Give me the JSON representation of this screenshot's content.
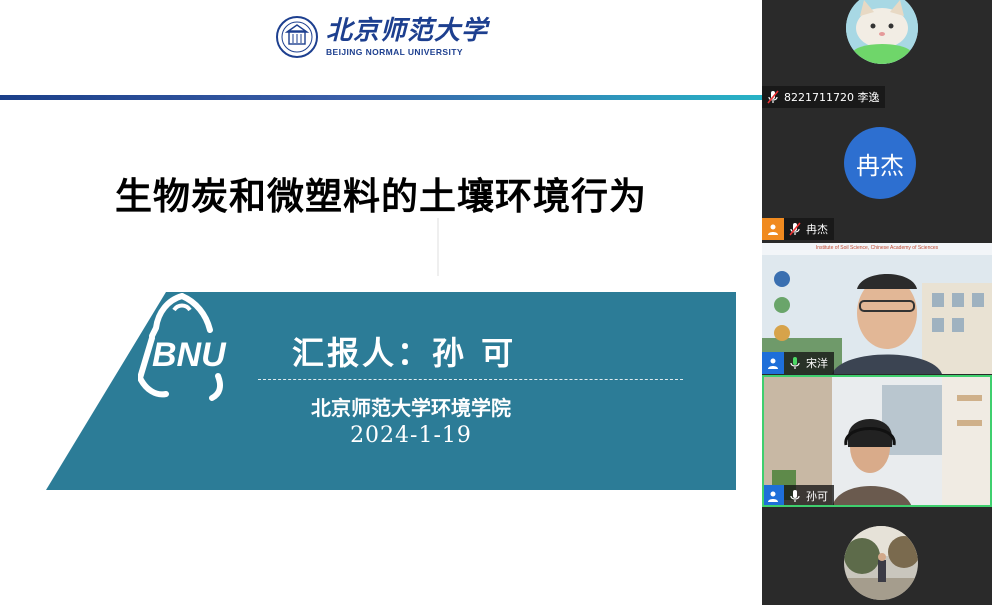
{
  "slide": {
    "logo_cn": "北京师范大学",
    "logo_en": "BEIJING NORMAL UNIVERSITY",
    "title": "生物炭和微塑料的土壤环境行为",
    "bnu_mark": "BNU",
    "presenter": "汇报人：孙 可",
    "school": "北京师范大学环境学院",
    "date": "2024-1-19"
  },
  "participants": [
    {
      "name": "8221711720 李逸",
      "avatar": "cat-photo-avatar",
      "mic": "muted"
    },
    {
      "name": "冉杰",
      "avatar_text": "冉杰",
      "role": "host",
      "mic": "muted"
    },
    {
      "name": "宋洋",
      "video": "webcam-man-institute-background",
      "mic": "on",
      "banner_text": "Institute of Soil Science, Chinese Academy of Sciences"
    },
    {
      "name": "孙可",
      "video": "webcam-woman-headset",
      "mic": "on",
      "active_speaker": true
    },
    {
      "avatar": "outdoor-photo-avatar"
    }
  ],
  "colors": {
    "banner": "#2c7c97",
    "brand_blue": "#1d3f8f",
    "host_badge": "#f08a1f",
    "member_badge": "#1e6fd9",
    "active_speaker": "#3fcf6e"
  }
}
